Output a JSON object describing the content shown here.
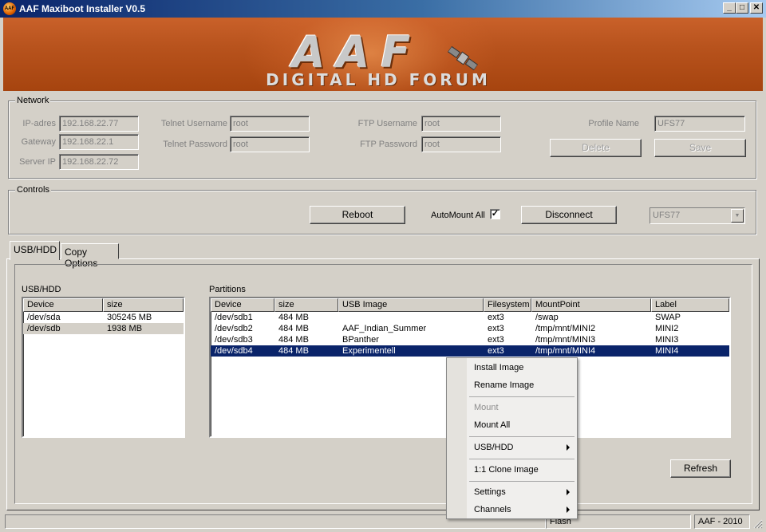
{
  "window": {
    "title": "AAF Maxiboot Installer V0.5",
    "icon_name": "aaf-app-icon",
    "icon_text": "AAF",
    "minimize_glyph": "_",
    "maximize_glyph": "□",
    "close_glyph": "✕"
  },
  "banner": {
    "logo": "AAF",
    "subtitle": "DIGITAL HD FORUM"
  },
  "network": {
    "legend": "Network",
    "ip_label": "IP-adres",
    "ip_value": "192.168.22.77",
    "gateway_label": "Gateway",
    "gateway_value": "192.168.22.1",
    "server_label": "Server IP",
    "server_value": "192.168.22.72",
    "telnet_user_label": "Telnet Username",
    "telnet_user_value": "root",
    "telnet_pass_label": "Telnet Password",
    "telnet_pass_value": "root",
    "ftp_user_label": "FTP Username",
    "ftp_user_value": "root",
    "ftp_pass_label": "FTP Password",
    "ftp_pass_value": "root",
    "profile_label": "Profile Name",
    "profile_value": "UFS77",
    "delete_label": "Delete",
    "save_label": "Save"
  },
  "controls": {
    "legend": "Controls",
    "reboot_label": "Reboot",
    "automount_label": "AutoMount All",
    "automount_checked": true,
    "check_glyph": "✓",
    "disconnect_label": "Disconnect",
    "profile_select": "UFS77",
    "dropdown_glyph": "▼"
  },
  "tabs": [
    {
      "label": "USB/HDD",
      "active": true
    },
    {
      "label": "Copy Options",
      "active": false
    }
  ],
  "usb_panel": {
    "title": "USB/HDD",
    "columns": [
      "Device",
      "size"
    ],
    "rows": [
      {
        "device": "/dev/sda",
        "size": "305245 MB",
        "selected": false
      },
      {
        "device": "/dev/sdb",
        "size": "1938 MB",
        "selected": true
      }
    ]
  },
  "partitions_panel": {
    "title": "Partitions",
    "columns": [
      "Device",
      "size",
      "USB Image",
      "Filesystem",
      "MountPoint",
      "Label"
    ],
    "rows": [
      {
        "device": "/dev/sdb1",
        "size": "484 MB",
        "image": "",
        "fs": "ext3",
        "mount": "/swap",
        "label": "SWAP",
        "selected": false
      },
      {
        "device": "/dev/sdb2",
        "size": "484 MB",
        "image": "AAF_Indian_Summer",
        "fs": "ext3",
        "mount": "/tmp/mnt/MINI2",
        "label": "MINI2",
        "selected": false
      },
      {
        "device": "/dev/sdb3",
        "size": "484 MB",
        "image": "BPanther",
        "fs": "ext3",
        "mount": "/tmp/mnt/MINI3",
        "label": "MINI3",
        "selected": false
      },
      {
        "device": "/dev/sdb4",
        "size": "484 MB",
        "image": "Experimentell",
        "fs": "ext3",
        "mount": "/tmp/mnt/MINI4",
        "label": "MINI4",
        "selected": true
      }
    ],
    "refresh_label": "Refresh"
  },
  "context_menu": {
    "install": "Install Image",
    "rename": "Rename Image",
    "mount": "Mount",
    "mount_all": "Mount All",
    "usb_hdd": "USB/HDD",
    "clone": "1:1 Clone Image",
    "settings": "Settings",
    "channels": "Channels"
  },
  "statusbar": {
    "flash": "Flash",
    "credit": "AAF - 2010"
  }
}
